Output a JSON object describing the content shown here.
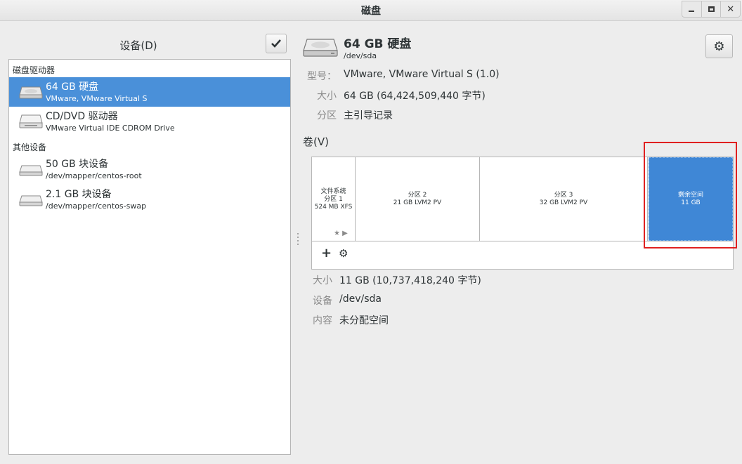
{
  "window": {
    "title": "磁盘"
  },
  "left_panel": {
    "header": "设备(D)",
    "sections": [
      {
        "label": "磁盘驱动器",
        "items": [
          {
            "name": "64 GB 硬盘",
            "sub": "VMware, VMware Virtual S",
            "selected": true,
            "icon": "harddisk-icon"
          },
          {
            "name": "CD/DVD 驱动器",
            "sub": "VMware Virtual IDE CDROM Drive",
            "selected": false,
            "icon": "optical-drive-icon"
          }
        ]
      },
      {
        "label": "其他设备",
        "items": [
          {
            "name": "50 GB 块设备",
            "sub": "/dev/mapper/centos-root",
            "selected": false,
            "icon": "block-device-icon"
          },
          {
            "name": "2.1 GB 块设备",
            "sub": "/dev/mapper/centos-swap",
            "selected": false,
            "icon": "block-device-icon"
          }
        ]
      }
    ]
  },
  "disk": {
    "title": "64 GB 硬盘",
    "path": "/dev/sda",
    "info": [
      {
        "label": "型号：",
        "value": "VMware, VMware Virtual S (1.0)"
      },
      {
        "label": "大小",
        "value": "64 GB (64,424,509,440 字节)"
      },
      {
        "label": "分区",
        "value": "主引导记录"
      }
    ]
  },
  "volumes": {
    "header": "卷(V)",
    "segments": [
      {
        "lines": [
          "文件系统",
          "分区 1",
          "524 MB XFS"
        ],
        "free": false
      },
      {
        "lines": [
          "分区 2",
          "21 GB LVM2 PV"
        ],
        "free": false
      },
      {
        "lines": [
          "分区 3",
          "32 GB LVM2 PV"
        ],
        "free": false
      },
      {
        "lines": [
          "剩余空间",
          "11 GB"
        ],
        "free": true
      }
    ],
    "toolbar": {
      "add": "+",
      "settings": "⚙"
    },
    "selected_info": [
      {
        "label": "大小",
        "value": "11 GB (10,737,418,240 字节)"
      },
      {
        "label": "设备",
        "value": "/dev/sda"
      },
      {
        "label": "内容",
        "value": "未分配空间"
      }
    ]
  },
  "colors": {
    "selection": "#4a90d9",
    "free_space": "#3f87d6",
    "highlight": "#e02020"
  }
}
